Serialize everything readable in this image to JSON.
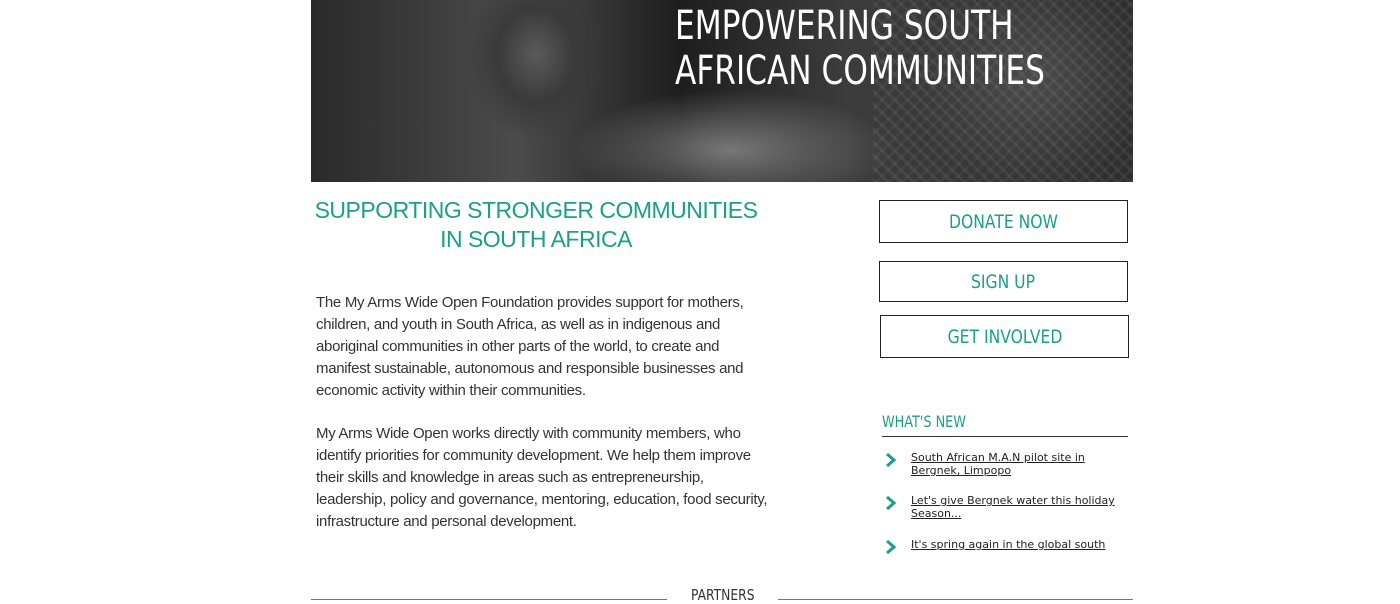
{
  "hero": {
    "headline_line1": "EMPOWERING SOUTH",
    "headline_line2": "AFRICAN COMMUNITIES"
  },
  "main": {
    "title": "SUPPORTING STRONGER COMMUNITIES IN SOUTH AFRICA",
    "paragraph1": " The My Arms Wide Open Foundation provides support for mothers, children, and youth in South Africa, as well as in indigenous and aboriginal communities in other parts of the world, to create and manifest sustainable, autonomous and responsible businesses and economic activity within their communities.",
    "paragraph2": "My Arms Wide Open works directly with community members, who identify priorities for community development. We help them improve their skills and knowledge in areas such as entrepreneurship, leadership, policy and governance, mentoring, education, food security, infrastructure and personal development."
  },
  "sidebar": {
    "donate_label": "DONATE NOW",
    "signup_label": "SIGN UP",
    "involved_label": "GET INVOLVED",
    "news_title": "WHAT'S NEW",
    "news": [
      {
        "label": "South African M.A.N pilot site in Bergnek, Limpopo",
        "icon": "chevron-right-icon"
      },
      {
        "label": "Let's give Bergnek water this holiday Season...",
        "icon": "chevron-right-icon"
      },
      {
        "label": "It's spring again in the global south",
        "icon": "chevron-right-icon"
      }
    ]
  },
  "footer": {
    "partners_label": "PARTNERS"
  },
  "colors": {
    "accent": "#1aa08a",
    "text": "#333333",
    "background": "#ffffff"
  }
}
